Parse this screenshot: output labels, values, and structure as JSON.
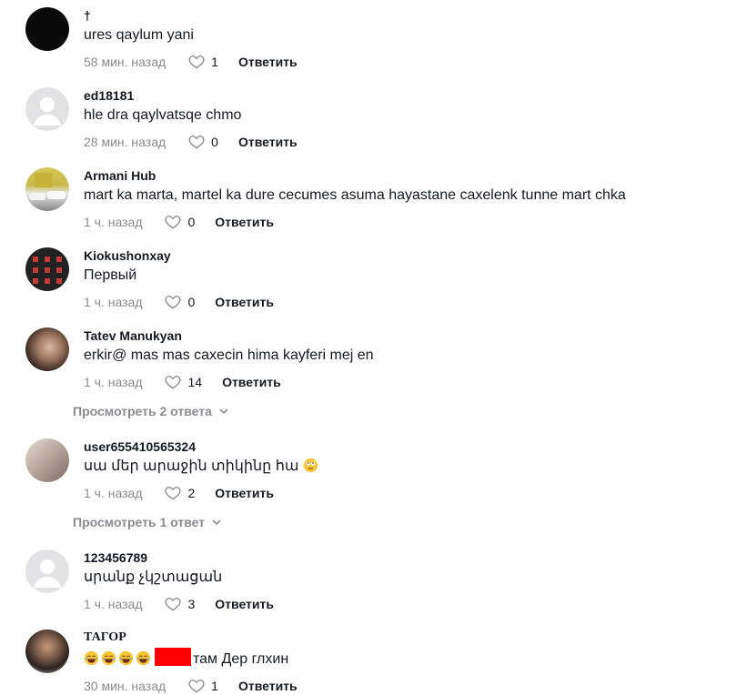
{
  "comments": [
    {
      "username": "†",
      "text": "ures qaylum yani",
      "time": "58 мин. назад",
      "likes": "1",
      "reply": "Ответить",
      "avatar": "black-avatar"
    },
    {
      "username": "ed18181",
      "text": "hle dra qaylvatsqe chmo",
      "time": "28 мин. назад",
      "likes": "0",
      "reply": "Ответить",
      "avatar": "default-avatar"
    },
    {
      "username": "Armani Hub",
      "text": "mart ka marta, martel ka dure cecumes asuma hayastane caxelenk tunne mart chka",
      "time": "1 ч. назад",
      "likes": "0",
      "reply": "Ответить",
      "avatar": "cars-photo-avatar"
    },
    {
      "username": "Kiokushonxay",
      "text": "Первый",
      "time": "1 ч. назад",
      "likes": "0",
      "reply": "Ответить",
      "avatar": "pattern-avatar"
    },
    {
      "username": "Tatev Manukyan",
      "text": "erkir@ mas mas caxecin hima kayferi mej en",
      "time": "1 ч. назад",
      "likes": "14",
      "reply": "Ответить",
      "avatar": "portrait-avatar"
    },
    {
      "username": "user655410565324",
      "text": "սա մեր արաջին տիկինը հա",
      "time": "1 ч. назад",
      "likes": "2",
      "reply": "Ответить",
      "avatar": "photo-avatar"
    },
    {
      "username": "123456789",
      "text": "սրանք չկշտացան",
      "time": "1 ч. назад",
      "likes": "3",
      "reply": "Ответить",
      "avatar": "default-avatar"
    },
    {
      "username": "ТАГОР",
      "text": "там Дер глхин",
      "time": "30 мин. назад",
      "likes": "1",
      "reply": "Ответить",
      "avatar": "man-photo-avatar"
    }
  ],
  "view_replies": [
    "Просмотреть 2 ответа",
    "Просмотреть 1 ответ"
  ],
  "colors": {
    "text": "#161823",
    "meta": "#8a8b91",
    "redaction": "#ff0000"
  }
}
